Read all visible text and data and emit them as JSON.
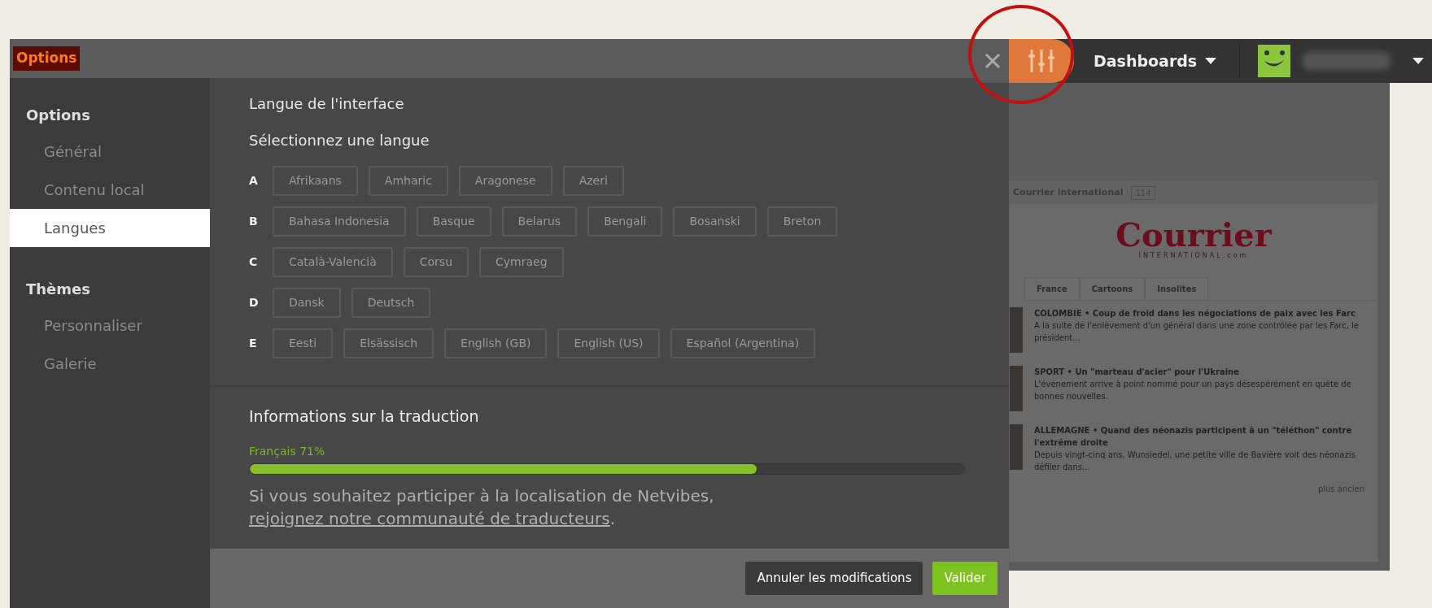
{
  "window": {
    "title": "Options"
  },
  "sidebar": [
    {
      "heading": "Options",
      "items": [
        {
          "label": "Général",
          "selected": false
        },
        {
          "label": "Contenu local",
          "selected": false
        },
        {
          "label": "Langues",
          "selected": true
        }
      ]
    },
    {
      "heading": "Thèmes",
      "items": [
        {
          "label": "Personnaliser",
          "selected": false
        },
        {
          "label": "Galerie",
          "selected": false
        }
      ]
    }
  ],
  "content": {
    "title": "Langue de l'interface",
    "subtitle": "Sélectionnez une langue",
    "language_groups": [
      {
        "letter": "A",
        "languages": [
          "Afrikaans",
          "Amharic",
          "Aragonese",
          "Azeri"
        ]
      },
      {
        "letter": "B",
        "languages": [
          "Bahasa Indonesia",
          "Basque",
          "Belarus",
          "Bengali",
          "Bosanski",
          "Breton"
        ]
      },
      {
        "letter": "C",
        "languages": [
          "Català-Valencià",
          "Corsu",
          "Cymraeg"
        ]
      },
      {
        "letter": "D",
        "languages": [
          "Dansk",
          "Deutsch"
        ]
      },
      {
        "letter": "E",
        "languages": [
          "Eesti",
          "Elsässisch",
          "English (GB)",
          "English (US)",
          "Español (Argentina)"
        ]
      }
    ]
  },
  "translation": {
    "heading": "Informations sur la traduction",
    "label": "Français 71%",
    "level": 0.71,
    "text": "Si vous souhaitez participer à la localisation de Netvibes, ",
    "link": "rejoignez notre communauté de traducteurs",
    "suffix": "."
  },
  "buttons": [
    {
      "label": "Annuler les modifications",
      "kind": "secondary"
    },
    {
      "label": "Valider",
      "kind": "primary"
    }
  ],
  "topbar": {
    "dashboards": "Dashboards"
  },
  "widget": {
    "title": "Courrier international",
    "count": "114",
    "logo": "Courrier",
    "logo_sub": "INTERNATIONAL.com",
    "tabs": [
      "France",
      "Cartoons",
      "Insolites"
    ],
    "items": [
      {
        "headline": "COLOMBIE • Coup de froid dans les négociations de paix avec les Farc",
        "summary": "A la suite de l'enlèvement d'un général dans une zone contrôlée par les Farc, le président..."
      },
      {
        "headline": "SPORT • Un \"marteau d'acier\" pour l'Ukraine",
        "summary": "L'événement arrive à point nommé pour un pays désespérément en quête de bonnes nouvelles."
      },
      {
        "headline": "ALLEMAGNE • Quand des néonazis participent à un \"téléthon\" contre l'extrême droite",
        "summary": "Depuis vingt-cinq ans, Wunsiedel, une petite ville de Bavière voit des néonazis défiler dans..."
      }
    ],
    "more": "plus ancien"
  }
}
